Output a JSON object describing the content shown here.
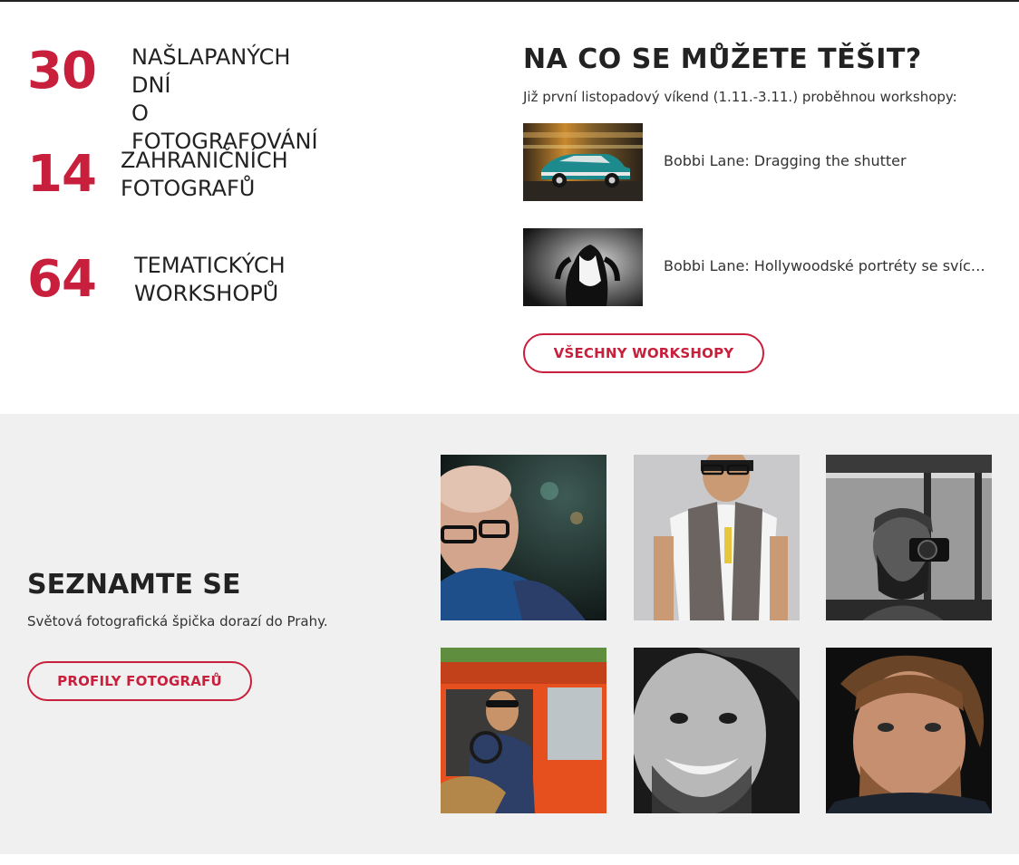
{
  "stats": [
    {
      "number": "30",
      "label_line1": "Našlapaných dní",
      "label_line2": "o fotografování"
    },
    {
      "number": "14",
      "label_line1": "Zahraničních",
      "label_line2": "fotografů"
    },
    {
      "number": "64",
      "label_line1": "Tematických",
      "label_line2": "workshopů"
    }
  ],
  "workshops": {
    "title": "NA CO SE MŮŽETE TĚŠIT?",
    "intro": "Již první listopadový víkend (1.11.-3.11.) proběhnou workshopy:",
    "items": [
      {
        "label": "Bobbi Lane: Dragging the shutter"
      },
      {
        "label": "Bobbi Lane: Hollywoodské portréty se svíce..."
      }
    ],
    "button_label": "VŠECHNY WORKSHOPY"
  },
  "meet": {
    "title": "SEZNAMTE SE",
    "text": "Světová fotografická špička dorazí do Prahy.",
    "button_label": "PROFILY FOTOGRAFŮ"
  },
  "colors": {
    "accent": "#c8203c",
    "section_gray": "#f0f0f0",
    "text_dark": "#222222"
  }
}
